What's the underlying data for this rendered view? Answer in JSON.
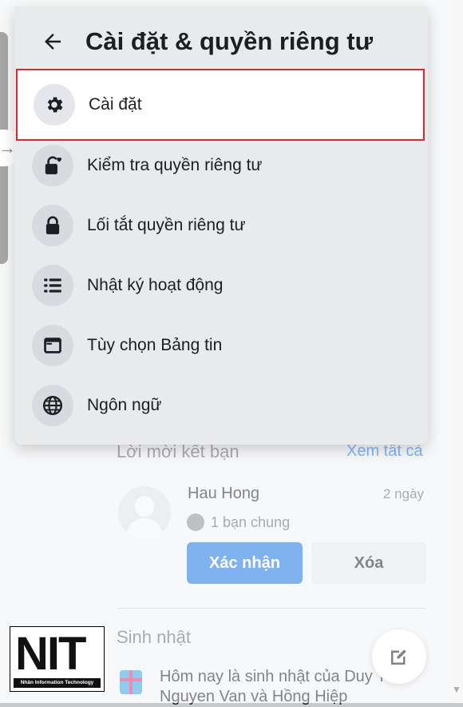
{
  "menu": {
    "title": "Cài đặt & quyền riêng tư",
    "items": [
      {
        "label": "Cài đặt",
        "icon": "gear-icon"
      },
      {
        "label": "Kiểm tra quyền riêng tư",
        "icon": "lock-heart-icon"
      },
      {
        "label": "Lối tắt quyền riêng tư",
        "icon": "lock-icon"
      },
      {
        "label": "Nhật ký hoạt động",
        "icon": "list-icon"
      },
      {
        "label": "Tùy chọn Bảng tin",
        "icon": "feed-icon"
      },
      {
        "label": "Ngôn ngữ",
        "icon": "globe-icon"
      }
    ],
    "highlight_color": "#e0242f"
  },
  "friend_requests": {
    "title": "Lời mời kết bạn",
    "see_all": "Xem tất cả",
    "request": {
      "name": "Hau Hong",
      "time": "2 ngày",
      "mutual": "1 bạn chung",
      "confirm_label": "Xác nhận",
      "delete_label": "Xóa"
    }
  },
  "birthdays": {
    "title": "Sinh nhật",
    "text": "Hôm nay là sinh nhật của Duy Thọ Nguyen Van và Hồng Hiệp"
  },
  "watermark": {
    "letters": "NIT",
    "caption": "Nhân Information Technology"
  },
  "colors": {
    "primary_blue": "#1b74e4",
    "text": "#1c1e21",
    "secondary_text": "#65676b"
  }
}
